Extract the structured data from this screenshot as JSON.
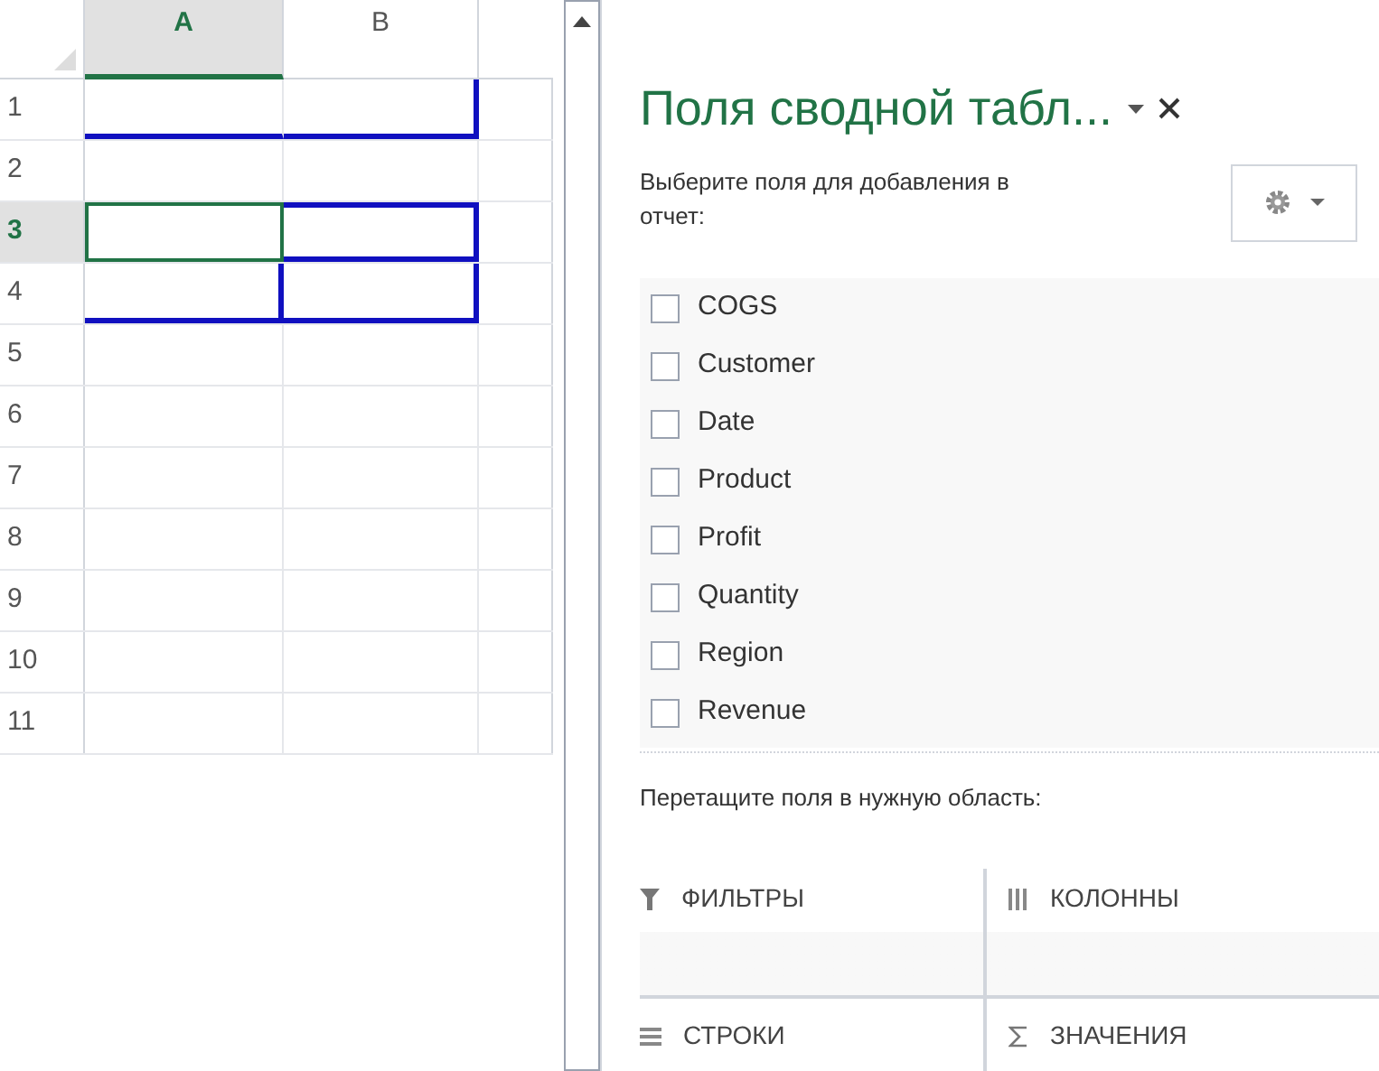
{
  "sheet": {
    "columns": [
      {
        "label": "A",
        "selected": true
      },
      {
        "label": "B",
        "selected": false
      }
    ],
    "rows": [
      {
        "label": "1",
        "selected": false,
        "cells": [
          {
            "selected": false,
            "border_bottom": true
          },
          {
            "selected": false,
            "border_bottom": true,
            "border_right": true
          }
        ]
      },
      {
        "label": "2",
        "selected": false,
        "cells": [
          {
            "selected": false
          },
          {
            "selected": false
          }
        ]
      },
      {
        "label": "3",
        "selected": true,
        "cells": [
          {
            "selected": true
          },
          {
            "selected": false,
            "border_top": true,
            "border_bottom": true,
            "border_right": true
          }
        ]
      },
      {
        "label": "4",
        "selected": false,
        "cells": [
          {
            "selected": false,
            "border_bottom": true,
            "border_right": true
          },
          {
            "selected": false,
            "border_bottom": true,
            "border_right": true
          }
        ]
      },
      {
        "label": "5",
        "selected": false,
        "cells": [
          {
            "selected": false
          },
          {
            "selected": false
          }
        ]
      },
      {
        "label": "6",
        "selected": false,
        "cells": [
          {
            "selected": false
          },
          {
            "selected": false
          }
        ]
      },
      {
        "label": "7",
        "selected": false,
        "cells": [
          {
            "selected": false
          },
          {
            "selected": false
          }
        ]
      },
      {
        "label": "8",
        "selected": false,
        "cells": [
          {
            "selected": false
          },
          {
            "selected": false
          }
        ]
      },
      {
        "label": "9",
        "selected": false,
        "cells": [
          {
            "selected": false
          },
          {
            "selected": false
          }
        ]
      },
      {
        "label": "10",
        "selected": false,
        "cells": [
          {
            "selected": false
          },
          {
            "selected": false
          }
        ]
      },
      {
        "label": "11",
        "selected": false,
        "cells": [
          {
            "selected": false
          },
          {
            "selected": false
          }
        ]
      }
    ]
  },
  "panel": {
    "title": "Поля сводной табл...",
    "prompt": "Выберите поля для добавления в отчет:",
    "fields": [
      {
        "label": "COGS",
        "checked": false
      },
      {
        "label": "Customer",
        "checked": false
      },
      {
        "label": "Date",
        "checked": false
      },
      {
        "label": "Product",
        "checked": false
      },
      {
        "label": "Profit",
        "checked": false
      },
      {
        "label": "Quantity",
        "checked": false
      },
      {
        "label": "Region",
        "checked": false
      },
      {
        "label": "Revenue",
        "checked": false
      }
    ],
    "drag_hint": "Перетащите поля в нужную область:",
    "areas": [
      {
        "kind": "filter",
        "label": "ФИЛЬТРЫ"
      },
      {
        "kind": "columns",
        "label": "КОЛОННЫ"
      },
      {
        "kind": "rows",
        "label": "СТРОКИ"
      },
      {
        "kind": "sum",
        "label": "ЗНАЧЕНИЯ"
      }
    ]
  }
}
